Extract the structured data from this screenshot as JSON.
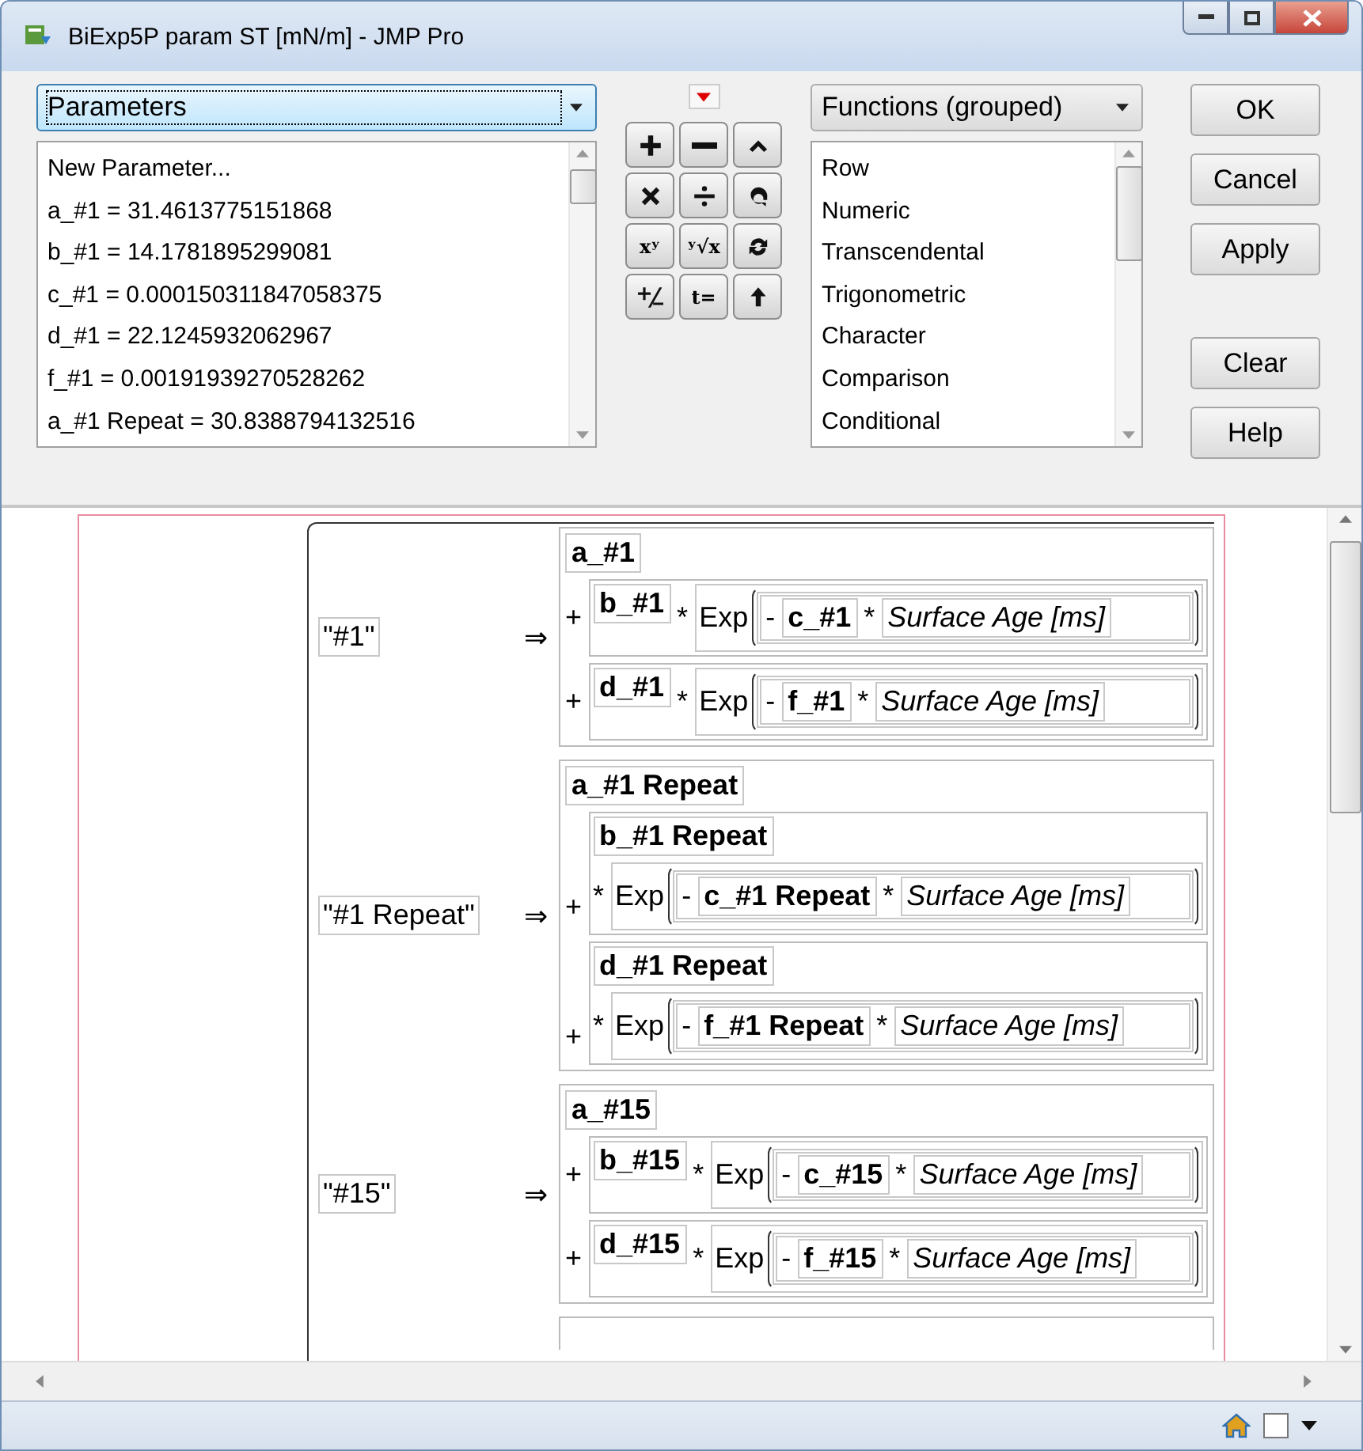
{
  "window": {
    "title": "BiExp5P param ST [mN/m] - JMP Pro"
  },
  "parameters_dropdown": {
    "value": "Parameters",
    "focused": true
  },
  "parameters_list": [
    "New Parameter...",
    "a_#1 = 31.4613775151868",
    "b_#1 = 14.1781895299081",
    "c_#1 = 0.000150311847058375",
    "d_#1 = 22.1245932062967",
    "f_#1 = 0.00191939270528262",
    "a_#1 Repeat = 30.8388794132516"
  ],
  "keypad": [
    {
      "kind": "icon"
    },
    {
      "kind": "icon"
    },
    {
      "kind": "icon"
    },
    {
      "kind": "icon"
    },
    {
      "kind": "icon"
    },
    {
      "kind": "icon"
    },
    {
      "kind": "text",
      "label": "xʸ"
    },
    {
      "kind": "text",
      "label": "ʸ√x"
    },
    {
      "kind": "icon"
    },
    {
      "kind": "icon"
    },
    {
      "kind": "text",
      "label": "t="
    },
    {
      "kind": "icon"
    }
  ],
  "functions_dropdown": {
    "value": "Functions (grouped)"
  },
  "functions_list": [
    "Row",
    "Numeric",
    "Transcendental",
    "Trigonometric",
    "Character",
    "Comparison",
    "Conditional"
  ],
  "buttons": [
    "OK",
    "Cancel",
    "Apply",
    "Clear",
    "Help"
  ],
  "status_bar": {
    "checkbox_checked": false
  },
  "formula": {
    "cases": [
      {
        "label": "\"#1\"",
        "arrow": "⇒",
        "intercept": "a_#1",
        "terms": [
          {
            "kind": "inline",
            "plus": "+",
            "coef": "b_#1",
            "times": "*",
            "func": "Exp",
            "neg": "-",
            "rate": "c_#1",
            "times2": "*",
            "variable": "Surface Age [ms]"
          },
          {
            "kind": "inline",
            "plus": "+",
            "coef": "d_#1",
            "times": "*",
            "func": "Exp",
            "neg": "-",
            "rate": "f_#1",
            "times2": "*",
            "variable": "Surface Age [ms]"
          }
        ]
      },
      {
        "label": "\"#1 Repeat\"",
        "arrow": "⇒",
        "intercept": "a_#1 Repeat",
        "terms": [
          {
            "kind": "stacked",
            "plus": "+",
            "coef": "b_#1 Repeat",
            "times": "*",
            "func": "Exp",
            "neg": "-",
            "rate": "c_#1 Repeat",
            "times2": "*",
            "variable": "Surface Age [ms]"
          },
          {
            "kind": "stacked",
            "plus": "+",
            "coef": "d_#1 Repeat",
            "times": "*",
            "func": "Exp",
            "neg": "-",
            "rate": "f_#1 Repeat",
            "times2": "*",
            "variable": "Surface Age [ms]"
          }
        ]
      },
      {
        "label": "\"#15\"",
        "arrow": "⇒",
        "intercept": "a_#15",
        "terms": [
          {
            "kind": "inline",
            "plus": "+",
            "coef": "b_#15",
            "times": "*",
            "func": "Exp",
            "neg": "-",
            "rate": "c_#15",
            "times2": "*",
            "variable": "Surface Age [ms]"
          },
          {
            "kind": "inline",
            "plus": "+",
            "coef": "d_#15",
            "times": "*",
            "func": "Exp",
            "neg": "-",
            "rate": "f_#15",
            "times2": "*",
            "variable": "Surface Age [ms]"
          }
        ]
      }
    ]
  }
}
